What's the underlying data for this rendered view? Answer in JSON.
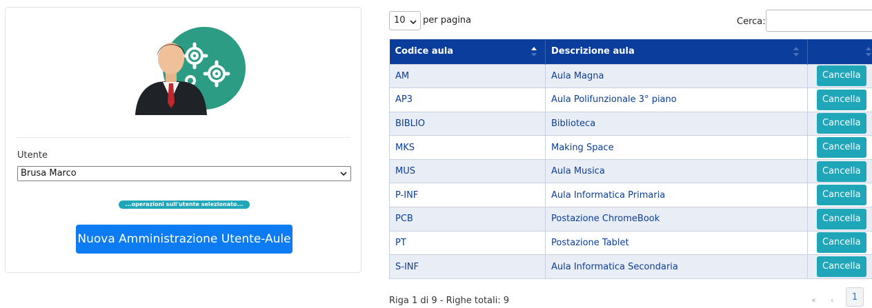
{
  "panel": {
    "user_label": "Utente",
    "user_value": "Brusa Marco",
    "ops_label": "...operazioni sull'utente selezionato...",
    "new_button": "Nuova Amministrazione Utente-Aule"
  },
  "table": {
    "length_value": "10",
    "length_suffix": "per pagina",
    "search_label": "Cerca:",
    "search_value": "",
    "columns": [
      "Codice aula",
      "Descrizione aula",
      ""
    ],
    "action_label": "Cancella",
    "rows": [
      {
        "code": "AM",
        "desc": "Aula Magna"
      },
      {
        "code": "AP3",
        "desc": "Aula Polifunzionale 3° piano"
      },
      {
        "code": "BIBLIO",
        "desc": "Biblioteca"
      },
      {
        "code": "MKS",
        "desc": "Making Space"
      },
      {
        "code": "MUS",
        "desc": "Aula Musica"
      },
      {
        "code": "P-INF",
        "desc": "Aula Informatica Primaria"
      },
      {
        "code": "PCB",
        "desc": "Postazione ChromeBook"
      },
      {
        "code": "PT",
        "desc": "Postazione Tablet"
      },
      {
        "code": "S-INF",
        "desc": "Aula Informatica Secondaria"
      }
    ],
    "info": "Riga 1 di 9 - Righe totali: 9",
    "pager": {
      "first": "«",
      "prev": "‹",
      "current": "1",
      "next": "›",
      "last": "»"
    }
  },
  "colors": {
    "header": "#0a3d9c",
    "accent_teal": "#1fa6b8",
    "primary_blue": "#0d7cf2"
  }
}
